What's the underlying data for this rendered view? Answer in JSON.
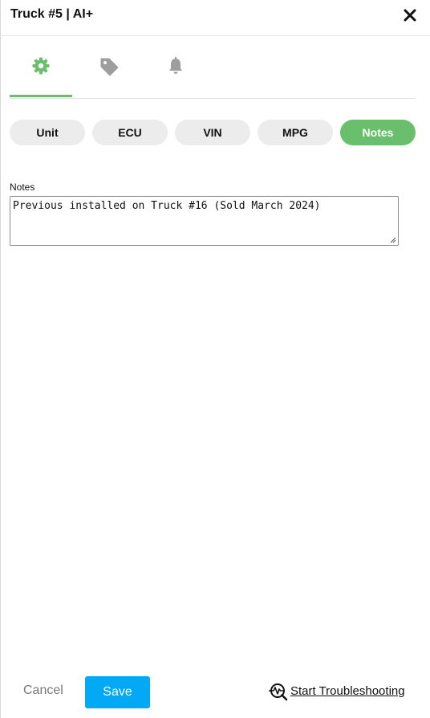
{
  "header": {
    "title": "Truck #5 | AI+",
    "close_icon": "close-icon"
  },
  "icon_tabs": [
    {
      "icon": "gear-icon",
      "active": true
    },
    {
      "icon": "tag-icon",
      "active": false
    },
    {
      "icon": "bell-icon",
      "active": false
    }
  ],
  "pills": [
    {
      "label": "Unit",
      "active": false
    },
    {
      "label": "ECU",
      "active": false
    },
    {
      "label": "VIN",
      "active": false
    },
    {
      "label": "MPG",
      "active": false
    },
    {
      "label": "Notes",
      "active": true
    }
  ],
  "notes": {
    "label": "Notes",
    "value": "Previous installed on Truck #16 (Sold March 2024)"
  },
  "footer": {
    "cancel_label": "Cancel",
    "save_label": "Save",
    "troubleshoot_label": "Start Troubleshooting",
    "troubleshoot_icon": "troubleshoot-magnifier-icon"
  },
  "colors": {
    "accent_green": "#6abf6c",
    "save_blue": "#03a9f4",
    "inactive_icon": "#9e9e9e"
  }
}
